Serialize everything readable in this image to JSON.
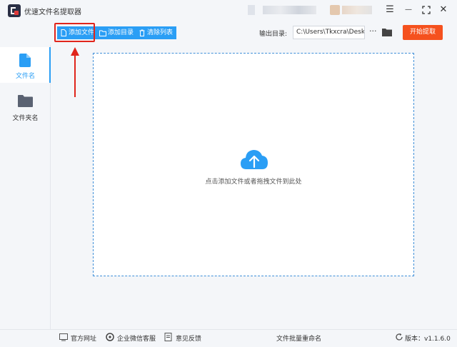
{
  "window": {
    "title": "优速文件名提取器",
    "controls": {
      "menu": "☰",
      "minimize": "—",
      "maximize": "⛶",
      "close": "✕"
    }
  },
  "toolbar": {
    "add_file_label": "添加文件",
    "add_folder_label": "添加目录",
    "clear_list_label": "清除列表",
    "output_dir_label": "输出目录:",
    "output_dir_value": "C:\\Users\\Tkxcra\\Desktop",
    "more_label": "···",
    "start_label": "开始提取"
  },
  "sidebar": {
    "items": [
      {
        "label": "文件名",
        "icon": "file-icon",
        "active": true
      },
      {
        "label": "文件夹名",
        "icon": "folder-icon",
        "active": false
      }
    ]
  },
  "dropzone": {
    "hint": "点击添加文件或者拖拽文件到此处",
    "icon": "cloud-upload-icon"
  },
  "footer": {
    "website_label": "官方网址",
    "wechat_label": "企业微信客服",
    "feedback_label": "意见反馈",
    "batch_rename_label": "文件批量重命名",
    "version_label": "版本：v1.1.6.0"
  },
  "colors": {
    "accent": "#2a9ef5",
    "start_button": "#f5511e",
    "highlight": "#e0251c"
  }
}
